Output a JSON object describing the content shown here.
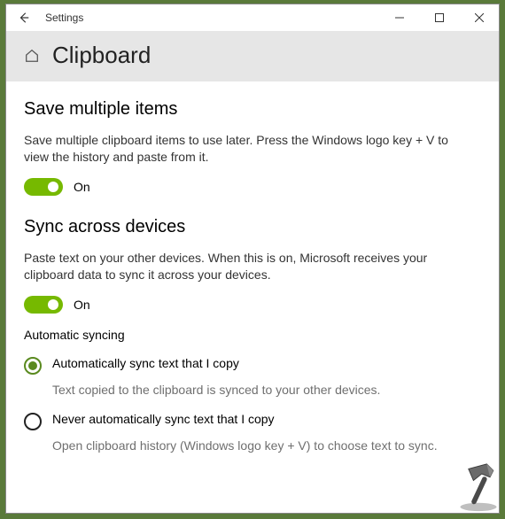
{
  "titlebar": {
    "app": "Settings"
  },
  "header": {
    "title": "Clipboard"
  },
  "section1": {
    "heading": "Save multiple items",
    "desc": "Save multiple clipboard items to use later. Press the Windows logo key + V to view the history and paste from it.",
    "toggle_state": "On"
  },
  "section2": {
    "heading": "Sync across devices",
    "desc": "Paste text on your other devices. When this is on, Microsoft receives your clipboard data to sync it across your devices.",
    "toggle_state": "On",
    "subheading": "Automatic syncing",
    "options": [
      {
        "label": "Automatically sync text that I copy",
        "help": "Text copied to the clipboard is synced to your other devices."
      },
      {
        "label": "Never automatically sync text that I copy",
        "help": "Open clipboard history (Windows logo key + V) to choose text to sync."
      }
    ]
  }
}
